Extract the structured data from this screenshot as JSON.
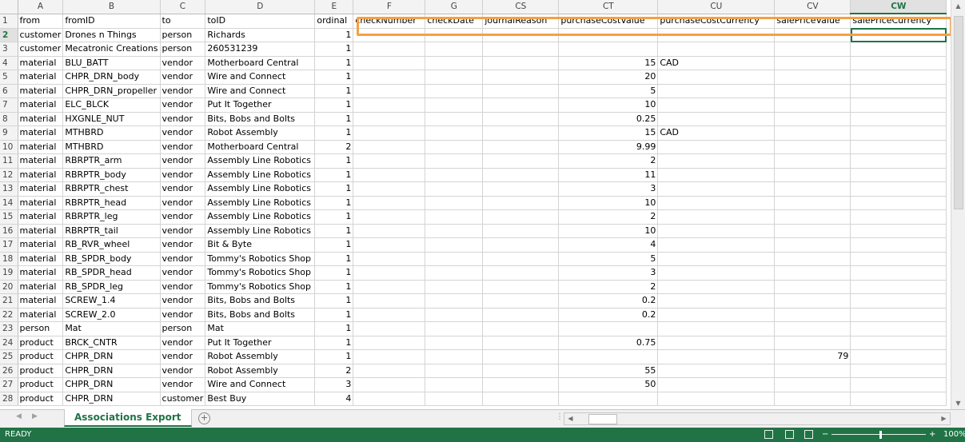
{
  "columns": [
    {
      "letter": "",
      "width": 22
    },
    {
      "letter": "A",
      "width": 53
    },
    {
      "letter": "B",
      "width": 111
    },
    {
      "letter": "C",
      "width": 53
    },
    {
      "letter": "D",
      "width": 137
    },
    {
      "letter": "E",
      "width": 48
    },
    {
      "letter": "F",
      "width": 90
    },
    {
      "letter": "G",
      "width": 72
    },
    {
      "letter": "CS",
      "width": 95
    },
    {
      "letter": "CT",
      "width": 124
    },
    {
      "letter": "CU",
      "width": 146
    },
    {
      "letter": "CV",
      "width": 95
    },
    {
      "letter": "CW",
      "width": 120
    }
  ],
  "active_column": "CW",
  "active_row": "2",
  "rows": [
    [
      "1",
      "from",
      "fromID",
      "to",
      "toID",
      "ordinal",
      "checkNumber",
      "checkDate",
      "journalReason",
      "purchaseCostValue",
      "purchaseCostCurrency",
      "salePriceValue",
      "salePriceCurrency"
    ],
    [
      "2",
      "customer",
      "Drones n Things",
      "person",
      "Richards",
      "1",
      "",
      "",
      "",
      "",
      "",
      "",
      ""
    ],
    [
      "3",
      "customer",
      "Mecatronic Creations",
      "person",
      "260531239",
      "1",
      "",
      "",
      "",
      "",
      "",
      "",
      ""
    ],
    [
      "4",
      "material",
      "BLU_BATT",
      "vendor",
      "Motherboard Central",
      "1",
      "",
      "",
      "",
      "15",
      "CAD",
      "",
      ""
    ],
    [
      "5",
      "material",
      "CHPR_DRN_body",
      "vendor",
      "Wire and Connect",
      "1",
      "",
      "",
      "",
      "20",
      "",
      "",
      ""
    ],
    [
      "6",
      "material",
      "CHPR_DRN_propeller",
      "vendor",
      "Wire and Connect",
      "1",
      "",
      "",
      "",
      "5",
      "",
      "",
      ""
    ],
    [
      "7",
      "material",
      "ELC_BLCK",
      "vendor",
      "Put It Together",
      "1",
      "",
      "",
      "",
      "10",
      "",
      "",
      ""
    ],
    [
      "8",
      "material",
      "HXGNLE_NUT",
      "vendor",
      "Bits, Bobs and Bolts",
      "1",
      "",
      "",
      "",
      "0.25",
      "",
      "",
      ""
    ],
    [
      "9",
      "material",
      "MTHBRD",
      "vendor",
      "Robot Assembly",
      "1",
      "",
      "",
      "",
      "15",
      "CAD",
      "",
      ""
    ],
    [
      "10",
      "material",
      "MTHBRD",
      "vendor",
      "Motherboard Central",
      "2",
      "",
      "",
      "",
      "9.99",
      "",
      "",
      ""
    ],
    [
      "11",
      "material",
      "RBRPTR_arm",
      "vendor",
      "Assembly Line Robotics",
      "1",
      "",
      "",
      "",
      "2",
      "",
      "",
      ""
    ],
    [
      "12",
      "material",
      "RBRPTR_body",
      "vendor",
      "Assembly Line Robotics",
      "1",
      "",
      "",
      "",
      "11",
      "",
      "",
      ""
    ],
    [
      "13",
      "material",
      "RBRPTR_chest",
      "vendor",
      "Assembly Line Robotics",
      "1",
      "",
      "",
      "",
      "3",
      "",
      "",
      ""
    ],
    [
      "14",
      "material",
      "RBRPTR_head",
      "vendor",
      "Assembly Line Robotics",
      "1",
      "",
      "",
      "",
      "10",
      "",
      "",
      ""
    ],
    [
      "15",
      "material",
      "RBRPTR_leg",
      "vendor",
      "Assembly Line Robotics",
      "1",
      "",
      "",
      "",
      "2",
      "",
      "",
      ""
    ],
    [
      "16",
      "material",
      "RBRPTR_tail",
      "vendor",
      "Assembly Line Robotics",
      "1",
      "",
      "",
      "",
      "10",
      "",
      "",
      ""
    ],
    [
      "17",
      "material",
      "RB_RVR_wheel",
      "vendor",
      "Bit & Byte",
      "1",
      "",
      "",
      "",
      "4",
      "",
      "",
      ""
    ],
    [
      "18",
      "material",
      "RB_SPDR_body",
      "vendor",
      "Tommy's Robotics Shop",
      "1",
      "",
      "",
      "",
      "5",
      "",
      "",
      ""
    ],
    [
      "19",
      "material",
      "RB_SPDR_head",
      "vendor",
      "Tommy's Robotics Shop",
      "1",
      "",
      "",
      "",
      "3",
      "",
      "",
      ""
    ],
    [
      "20",
      "material",
      "RB_SPDR_leg",
      "vendor",
      "Tommy's Robotics Shop",
      "1",
      "",
      "",
      "",
      "2",
      "",
      "",
      ""
    ],
    [
      "21",
      "material",
      "SCREW_1.4",
      "vendor",
      "Bits, Bobs and Bolts",
      "1",
      "",
      "",
      "",
      "0.2",
      "",
      "",
      ""
    ],
    [
      "22",
      "material",
      "SCREW_2.0",
      "vendor",
      "Bits, Bobs and Bolts",
      "1",
      "",
      "",
      "",
      "0.2",
      "",
      "",
      ""
    ],
    [
      "23",
      "person",
      "Mat",
      "person",
      "Mat",
      "1",
      "",
      "",
      "",
      "",
      "",
      "",
      ""
    ],
    [
      "24",
      "product",
      "BRCK_CNTR",
      "vendor",
      "Put It Together",
      "1",
      "",
      "",
      "",
      "0.75",
      "",
      "",
      ""
    ],
    [
      "25",
      "product",
      "CHPR_DRN",
      "vendor",
      "Robot Assembly",
      "1",
      "",
      "",
      "",
      "",
      "",
      "79",
      ""
    ],
    [
      "26",
      "product",
      "CHPR_DRN",
      "vendor",
      "Robot Assembly",
      "2",
      "",
      "",
      "",
      "55",
      "",
      "",
      ""
    ],
    [
      "27",
      "product",
      "CHPR_DRN",
      "vendor",
      "Wire and Connect",
      "3",
      "",
      "",
      "",
      "50",
      "",
      "",
      ""
    ],
    [
      "28",
      "product",
      "CHPR_DRN",
      "customer",
      "Best Buy",
      "4",
      "",
      "",
      "",
      "",
      "",
      "",
      ""
    ]
  ],
  "sheet_tab": "Associations Export",
  "status": "READY",
  "zoom": "100%",
  "colors": {
    "accent": "#217346",
    "highlight": "#f5a043"
  }
}
